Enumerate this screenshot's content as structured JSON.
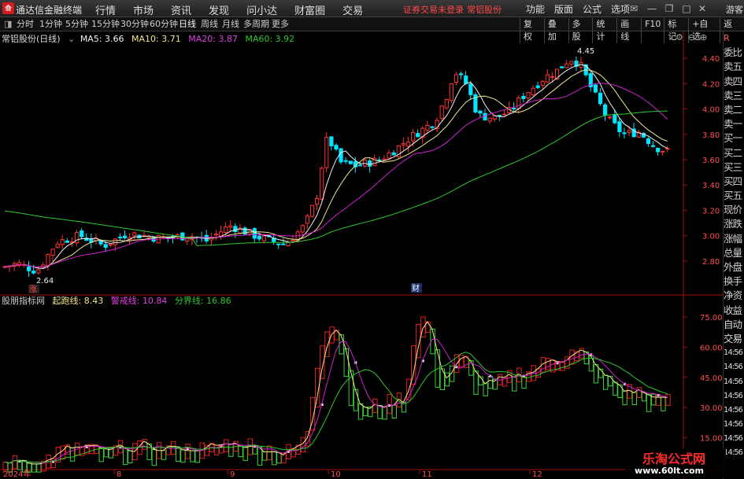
{
  "titlebar": {
    "logo": "⟰",
    "app_name": "通达信金融终端",
    "menu": [
      "行情",
      "市场",
      "资讯",
      "发现",
      "问小达",
      "财富圈",
      "交易"
    ],
    "notice_left": "证券交易未登录",
    "notice_right": "常铝股份",
    "right_menu": [
      "功能",
      "版面",
      "公式",
      "选项"
    ],
    "guest": "游客"
  },
  "toolbar": {
    "periods": [
      "分时",
      "1分钟",
      "5分钟",
      "15分钟",
      "30分钟",
      "60分钟",
      "日线",
      "周线",
      "月线",
      "多周期",
      "更多"
    ],
    "active_period": "日线",
    "right_tools": [
      "复权",
      "叠加",
      "多股",
      "统计",
      "画线",
      "F10",
      "标记",
      "+自选",
      "返回"
    ]
  },
  "main_panel": {
    "stock_label": "常铝股份(日线)",
    "ma5_label": "MA5: 3.66",
    "ma10_label": "MA10: 3.71",
    "ma20_label": "MA20: 3.87",
    "ma60_label": "MA60: 3.92",
    "high_marker": "4.45",
    "low_marker": "2.64",
    "zhang_marker": "涨",
    "cai_marker": "财",
    "y_ticks": [
      "4.40",
      "4.20",
      "4.00",
      "3.80",
      "3.60",
      "3.40",
      "3.20",
      "3.00",
      "2.80"
    ]
  },
  "indicator_panel": {
    "name": "股朋指标网",
    "line1_label": "起跑线: 8.43",
    "line2_label": "警戒线: 10.84",
    "line3_label": "分界线: 16.86",
    "y_ticks": [
      "75.00",
      "60.00",
      "45.00",
      "30.00",
      "15.00"
    ]
  },
  "x_axis": [
    "2024年",
    "8",
    "9",
    "10",
    "11",
    "12"
  ],
  "side_panel": {
    "items": [
      "委比",
      "卖五",
      "卖四",
      "卖三",
      "卖二",
      "卖一",
      "买一",
      "买二",
      "买三",
      "买四",
      "买五",
      "现价",
      "涨跌",
      "涨幅",
      "总量",
      "外盘",
      "换手",
      "净资",
      "收益"
    ],
    "lower_items": [
      "自动",
      "交易",
      "14:56",
      "14:56",
      "14:56",
      "14:56",
      "14:56",
      "14:56",
      "14:56",
      "14:56",
      "14:56",
      "14:56"
    ]
  },
  "watermark": {
    "title": "乐淘公式网",
    "url": "www.60lt.com"
  },
  "colors": {
    "up": "#ff3232",
    "down": "#00e5ff",
    "ma5": "#f0f0f0",
    "ma10": "#f0e68c",
    "ma20": "#d020d0",
    "ma60": "#2ec82e",
    "ind_up": "#e02020",
    "ind_down": "#3bd03b"
  },
  "chart_data": {
    "type": "candlestick",
    "x_labels": [
      "2024年",
      "8",
      "9",
      "10",
      "11",
      "12"
    ],
    "ylim": [
      2.6,
      4.55
    ],
    "high": 4.45,
    "low": 2.64,
    "ma_latest": {
      "MA5": 3.66,
      "MA10": 3.71,
      "MA20": 3.87,
      "MA60": 3.92
    },
    "indicator": {
      "ylim": [
        0,
        80
      ],
      "latest": {
        "起跑线": 8.43,
        "警戒线": 10.84,
        "分界线": 16.86
      }
    }
  }
}
